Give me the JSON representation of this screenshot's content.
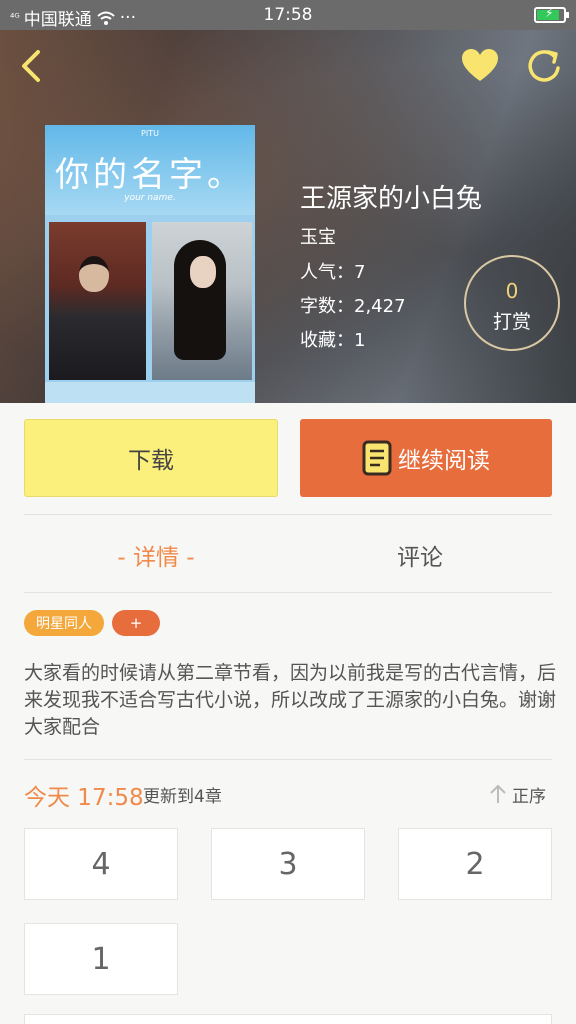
{
  "status_bar": {
    "signal": "⁴ᴳ",
    "carrier": "中国联通",
    "more": "···",
    "time": "17:58"
  },
  "book": {
    "title": "王源家的小白兔",
    "author": "玉宝",
    "popularity_label": "人气：",
    "popularity": "7",
    "words_label": "字数：",
    "words": "2,427",
    "favorites_label": "收藏：",
    "favorites": "1",
    "tip_count": "0",
    "tip_label": "打赏",
    "cover": {
      "small_text": "PITU",
      "title": "你的名字。",
      "subtitle": "your name."
    }
  },
  "actions": {
    "download": "下载",
    "continue_read": "继续阅读"
  },
  "tabs": {
    "detail": "- 详情 -",
    "comment": "评论"
  },
  "tags": {
    "category": "明星同人",
    "add": "+"
  },
  "description": "大家看的时候请从第二章节看，因为以前我是写的古代言情，后来发现我不适合写古代小说，所以改成了王源家的小白兔。谢谢大家配合",
  "update": {
    "time": "今天 17:58",
    "text": "更新到4章",
    "sort": "正序"
  },
  "chapters": [
    "4",
    "3",
    "2",
    "1"
  ],
  "colors": {
    "accent_orange": "#e86d3d",
    "accent_light_orange": "#f08a4b",
    "download_yellow": "#fcf07d",
    "tag_orange": "#f4a73a",
    "heart_yellow": "#f8e46e"
  },
  "icons": {
    "back": "chevron-left-icon",
    "favorite": "heart-icon",
    "share": "refresh-icon",
    "read": "book-icon",
    "sort": "arrow-up-icon"
  }
}
